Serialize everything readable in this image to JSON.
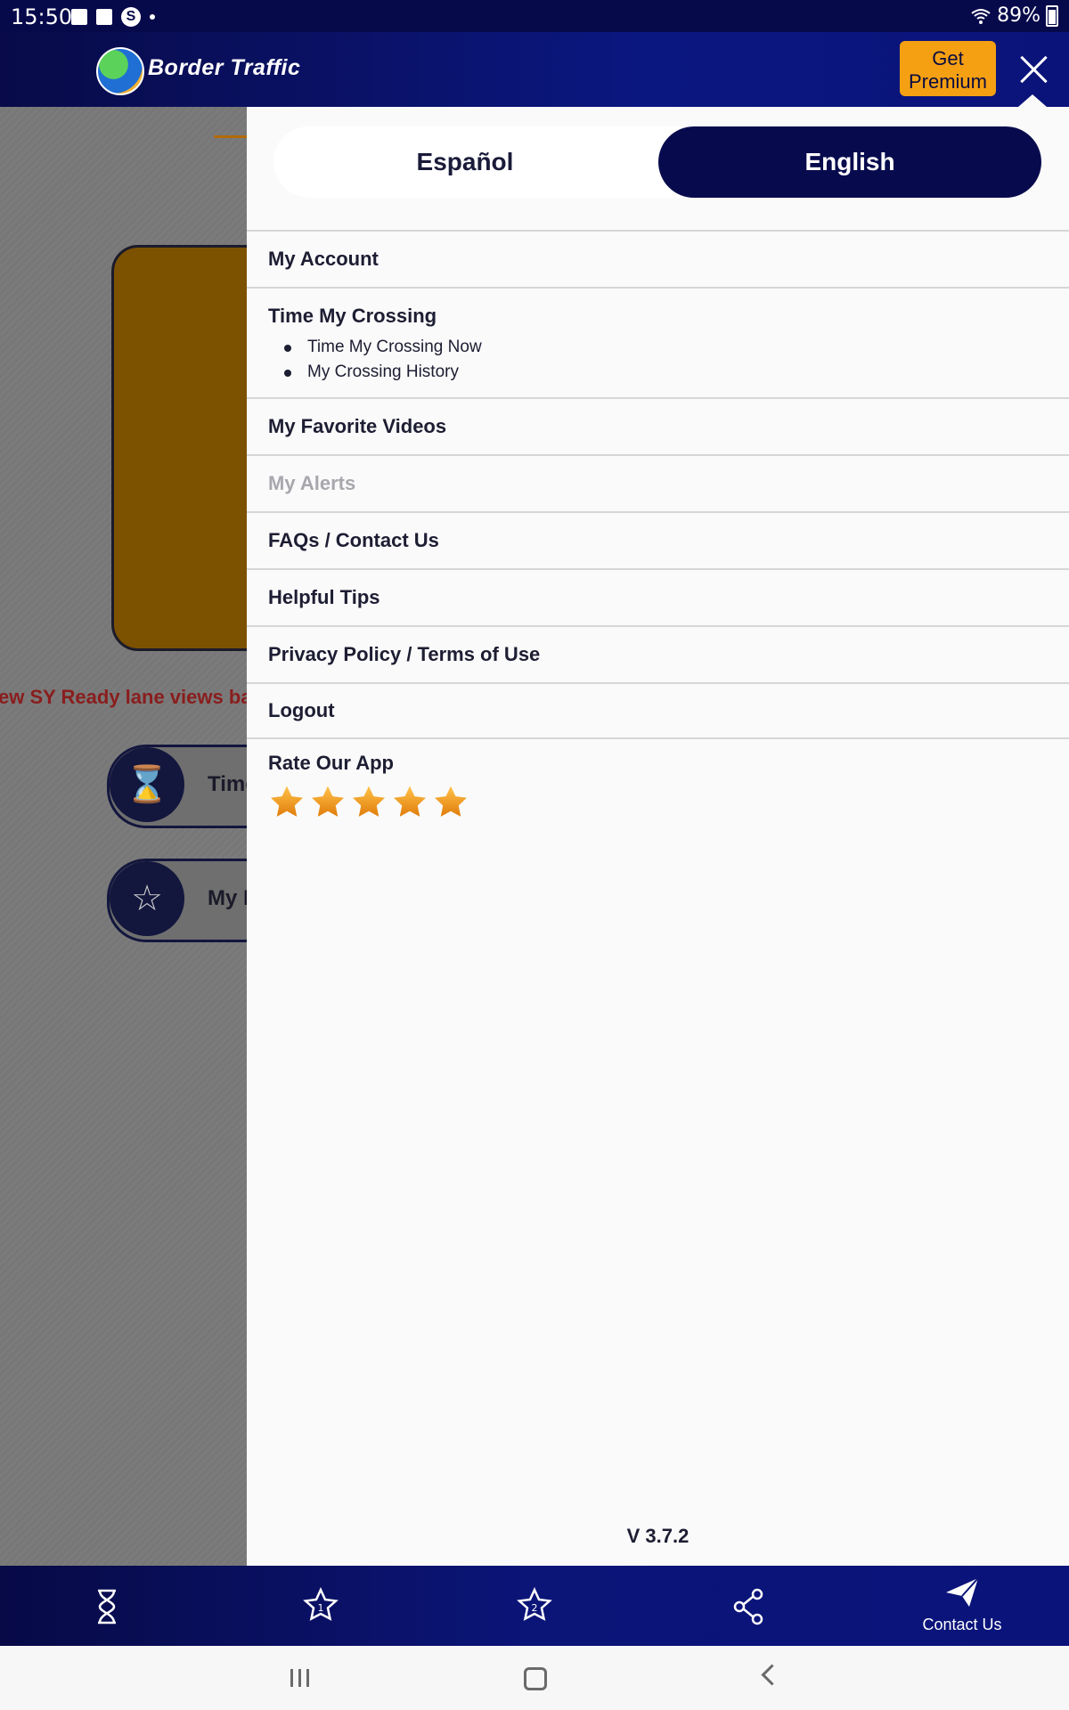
{
  "status_bar": {
    "time": "15:50",
    "battery": "89%"
  },
  "header": {
    "app_name": "Border Traffic",
    "premium_line1": "Get",
    "premium_line2": "Premium"
  },
  "background": {
    "ticker": "ew SY Ready lane views back",
    "pill1_label": "Time",
    "pill2_label": "My F"
  },
  "drawer": {
    "language": {
      "spanish": "Español",
      "english": "English",
      "selected": "English"
    },
    "menu": {
      "my_account": "My Account",
      "time_my_crossing": "Time My Crossing",
      "time_my_crossing_now": "Time My Crossing Now",
      "my_crossing_history": "My Crossing History",
      "my_favorite_videos": "My Favorite Videos",
      "my_alerts": "My Alerts",
      "faqs_contact": "FAQs / Contact Us",
      "helpful_tips": "Helpful Tips",
      "privacy_terms": "Privacy Policy / Terms of Use",
      "logout": "Logout"
    },
    "rate": {
      "title": "Rate Our App",
      "stars": 5
    },
    "version": "V 3.7.2"
  },
  "bottom_nav": {
    "items": [
      "hourglass-icon",
      "favorite-1-icon",
      "favorite-2-icon",
      "share-icon",
      "contact-icon"
    ],
    "contact_label": "Contact Us"
  },
  "colors": {
    "navy": "#070b4d",
    "accent_orange": "#f5a013"
  }
}
